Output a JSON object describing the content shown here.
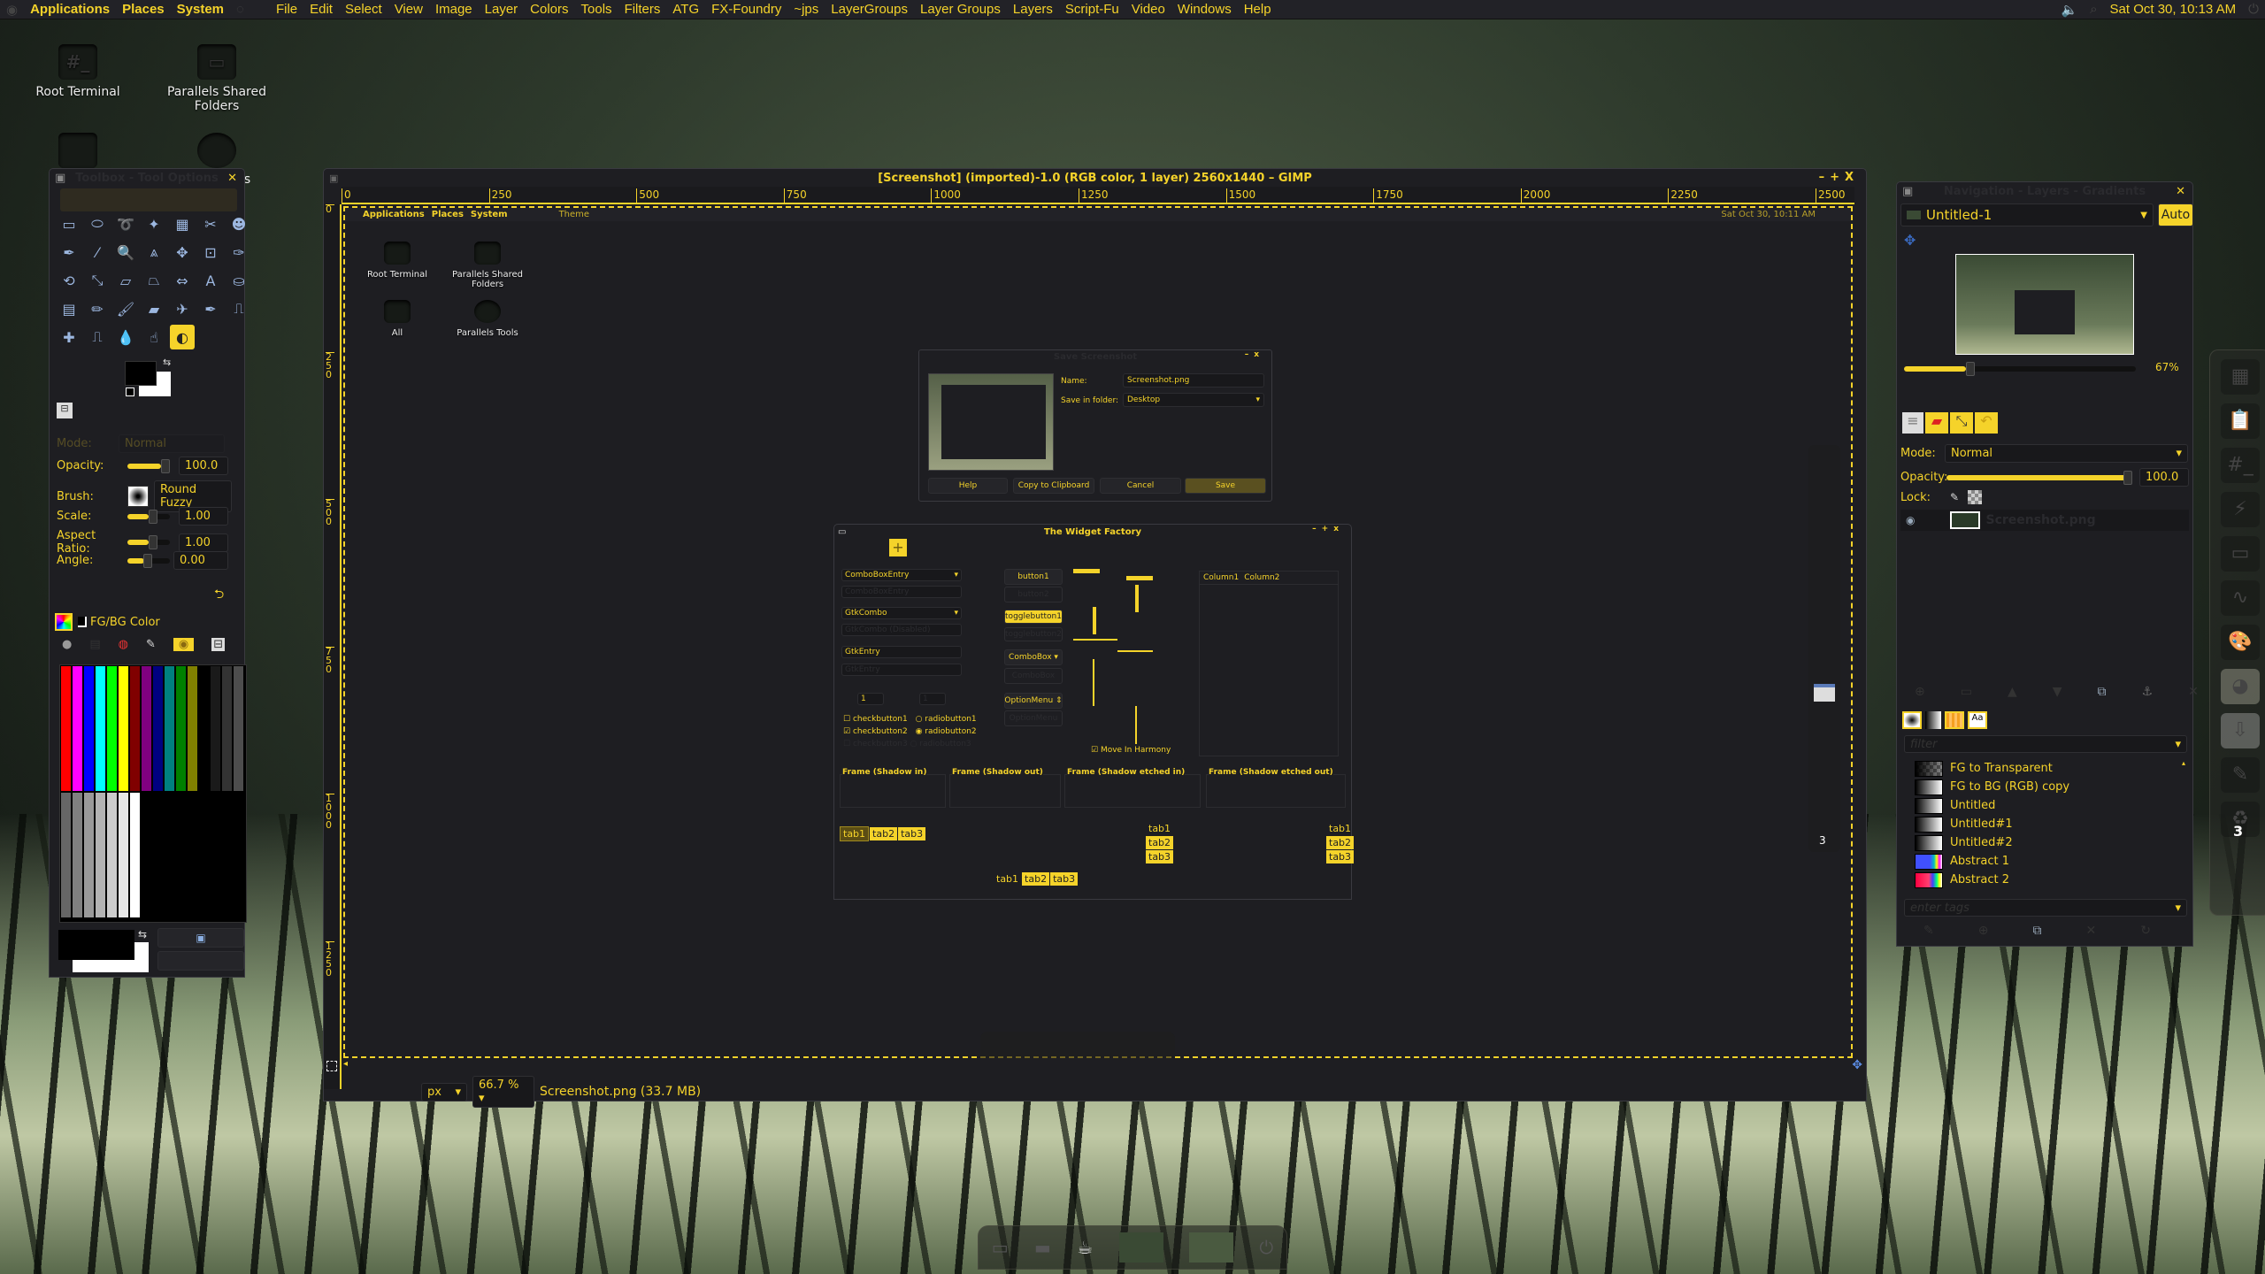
{
  "top_panel": {
    "menus": [
      "Applications",
      "Places",
      "System"
    ],
    "gimp_menus": [
      "File",
      "Edit",
      "Select",
      "View",
      "Image",
      "Layer",
      "Colors",
      "Tools",
      "Filters",
      "ATG",
      "FX-Foundry",
      "~jps",
      "LayerGroups",
      "Layer Groups",
      "Layers",
      "Script-Fu",
      "Video",
      "Windows",
      "Help"
    ],
    "clock": "Sat Oct 30, 10:13 AM"
  },
  "desktop": {
    "icons": [
      {
        "label": "Root Terminal"
      },
      {
        "label": "Parallels Shared Folders"
      }
    ],
    "partial_label": "ls"
  },
  "toolbox": {
    "title": "Toolbox - Tool Options",
    "tools": [
      "rect-select",
      "ellipse-select",
      "free-select",
      "fuzzy-select",
      "select-by-color",
      "scissors",
      "foreground-select",
      "paths",
      "color-picker",
      "zoom",
      "measure",
      "move",
      "align",
      "crop",
      "rotate",
      "scale",
      "shear",
      "perspective",
      "flip",
      "text",
      "bucket-fill",
      "blend",
      "pencil",
      "paintbrush",
      "eraser",
      "airbrush",
      "ink",
      "clone",
      "heal",
      "perspective-clone",
      "blur",
      "smudge",
      "dodge-burn"
    ],
    "active_tool": "dodge-burn",
    "options": {
      "mode_label": "Mode:",
      "mode_value": "Normal",
      "opacity_label": "Opacity:",
      "opacity_value": "100.0",
      "opacity_fraction": 1.0,
      "brush_label": "Brush:",
      "brush_value": "Round Fuzzy",
      "scale_label": "Scale:",
      "scale_value": "1.00",
      "aspect_label": "Aspect Ratio:",
      "aspect_value": "1.00",
      "angle_label": "Angle:",
      "angle_value": "0.00"
    },
    "fgbg": {
      "tab_label": "FG/BG Color",
      "palette_top": [
        "#ff0000",
        "#ff00ff",
        "#0000ff",
        "#00ffff",
        "#00ff00",
        "#ffff00",
        "#800000",
        "#800080",
        "#000080",
        "#008080",
        "#008000",
        "#808000",
        "#000000",
        "#1a1a1a",
        "#333333",
        "#4d4d4d"
      ],
      "palette_bottom": [
        "#666666",
        "#808080",
        "#999999",
        "#b3b3b3",
        "#cccccc",
        "#e6e6e6",
        "#ffffff"
      ]
    }
  },
  "image_window": {
    "title": "[Screenshot] (imported)-1.0 (RGB color, 1 layer) 2560x1440 – GIMP",
    "ruler_h": [
      "0",
      "250",
      "500",
      "750",
      "1000",
      "1250",
      "1500",
      "1750",
      "2000",
      "2250",
      "2500"
    ],
    "ruler_v": [
      "0",
      "250",
      "500",
      "750",
      "1000",
      "1250"
    ],
    "unit": "px",
    "zoom": "66.7 %",
    "status": "Screenshot.png (33.7 MB)",
    "inner_panel": {
      "menus": [
        "Applications",
        "Places",
        "System"
      ],
      "theme": "Theme",
      "clock": "Sat Oct 30, 10:11 AM"
    },
    "inner_icons": [
      "Root Terminal",
      "Parallels Shared Folders",
      "All",
      "Parallels Tools"
    ]
  },
  "save_dialog": {
    "title": "Save Screenshot",
    "name_label": "Name:",
    "name_value": "Screenshot.png",
    "folder_label": "Save in folder:",
    "folder_value": "Desktop",
    "buttons": [
      "Help",
      "Copy to Clipboard",
      "Cancel",
      "Save"
    ]
  },
  "widget_factory": {
    "title": "The Widget Factory",
    "combo_entry": "ComboBoxEntry",
    "combo_entry_disabled": "ComboBoxEntry",
    "gtk_combo": "GtkCombo",
    "gtk_combo_disabled": "GtkCombo (Disabled)",
    "gtk_entry": "GtkEntry",
    "gtk_entry_disabled": "GtkEntry",
    "spin_value": "1",
    "spin_disabled": "1",
    "checks": [
      "checkbutton1",
      "checkbutton2",
      "checkbutton3"
    ],
    "radios": [
      "radiobutton1",
      "radiobutton2",
      "radiobutton3"
    ],
    "button1": "button1",
    "button2": "button2",
    "toggle1": "togglebutton1",
    "toggle2": "togglebutton2",
    "combobox": "ComboBox",
    "combobox_disabled": "ComboBox",
    "optionmenu": "OptionMenu",
    "optionmenu_disabled": "OptionMenu",
    "move_in_harmony": "Move In Harmony",
    "columns": [
      "Column1",
      "Column2"
    ],
    "frames": [
      "Frame (Shadow in)",
      "Frame (Shadow out)",
      "Frame (Shadow etched in)",
      "Frame (Shadow etched out)"
    ],
    "tabs": [
      "tab1",
      "tab2",
      "tab3"
    ],
    "progress": {
      "h1": 0.55,
      "h2": 0.55,
      "v1": 0.55,
      "v2": 0.55,
      "scale_h1": 0.55,
      "scale_h2": 0.45,
      "scale_v1": 0.55,
      "scale_v2": 0.45
    }
  },
  "right_dock": {
    "title": "Navigation - Layers - Gradients",
    "image_select": "Untitled-1",
    "auto_button": "Auto",
    "nav_zoom": "67%",
    "nav_zoom_fraction": 0.67,
    "layers": {
      "mode_label": "Mode:",
      "mode_value": "Normal",
      "opacity_label": "Opacity:",
      "opacity_value": "100.0",
      "lock_label": "Lock:",
      "layer_name": "Screenshot.png"
    },
    "gradients": {
      "filter_placeholder": "filter",
      "tags_placeholder": "enter tags",
      "items": [
        {
          "name": "FG to Transparent",
          "css": "linear-gradient(90deg,#000,rgba(0,0,0,0)),repeating-conic-gradient(#555 0 25%,#888 0 50%) 0 0/8px 8px"
        },
        {
          "name": "FG to BG (RGB) copy",
          "css": "linear-gradient(90deg,#000,#fff)"
        },
        {
          "name": "Untitled",
          "css": "linear-gradient(90deg,#000,#fff)"
        },
        {
          "name": "Untitled#1",
          "css": "linear-gradient(90deg,#000,#fff)"
        },
        {
          "name": "Untitled#2",
          "css": "linear-gradient(90deg,#000,#fff)"
        },
        {
          "name": "Abstract 1",
          "css": "linear-gradient(90deg,#4050ff 0%,#4050ff 55%,#00c0c0 70%,#ffff00 80%,#ff00ff 90%,#ffffff 100%)"
        },
        {
          "name": "Abstract 2",
          "css": "linear-gradient(90deg,#ff0040 0%,#ff4070 50%,#4040ff 65%,#00ff80 80%,#ffff00 90%,#ffffff 100%)"
        }
      ]
    }
  },
  "dock_badge": "3",
  "colors": {
    "accent": "#f5d32a",
    "panel_bg": "#222227",
    "window_bg": "#1e1e22"
  }
}
